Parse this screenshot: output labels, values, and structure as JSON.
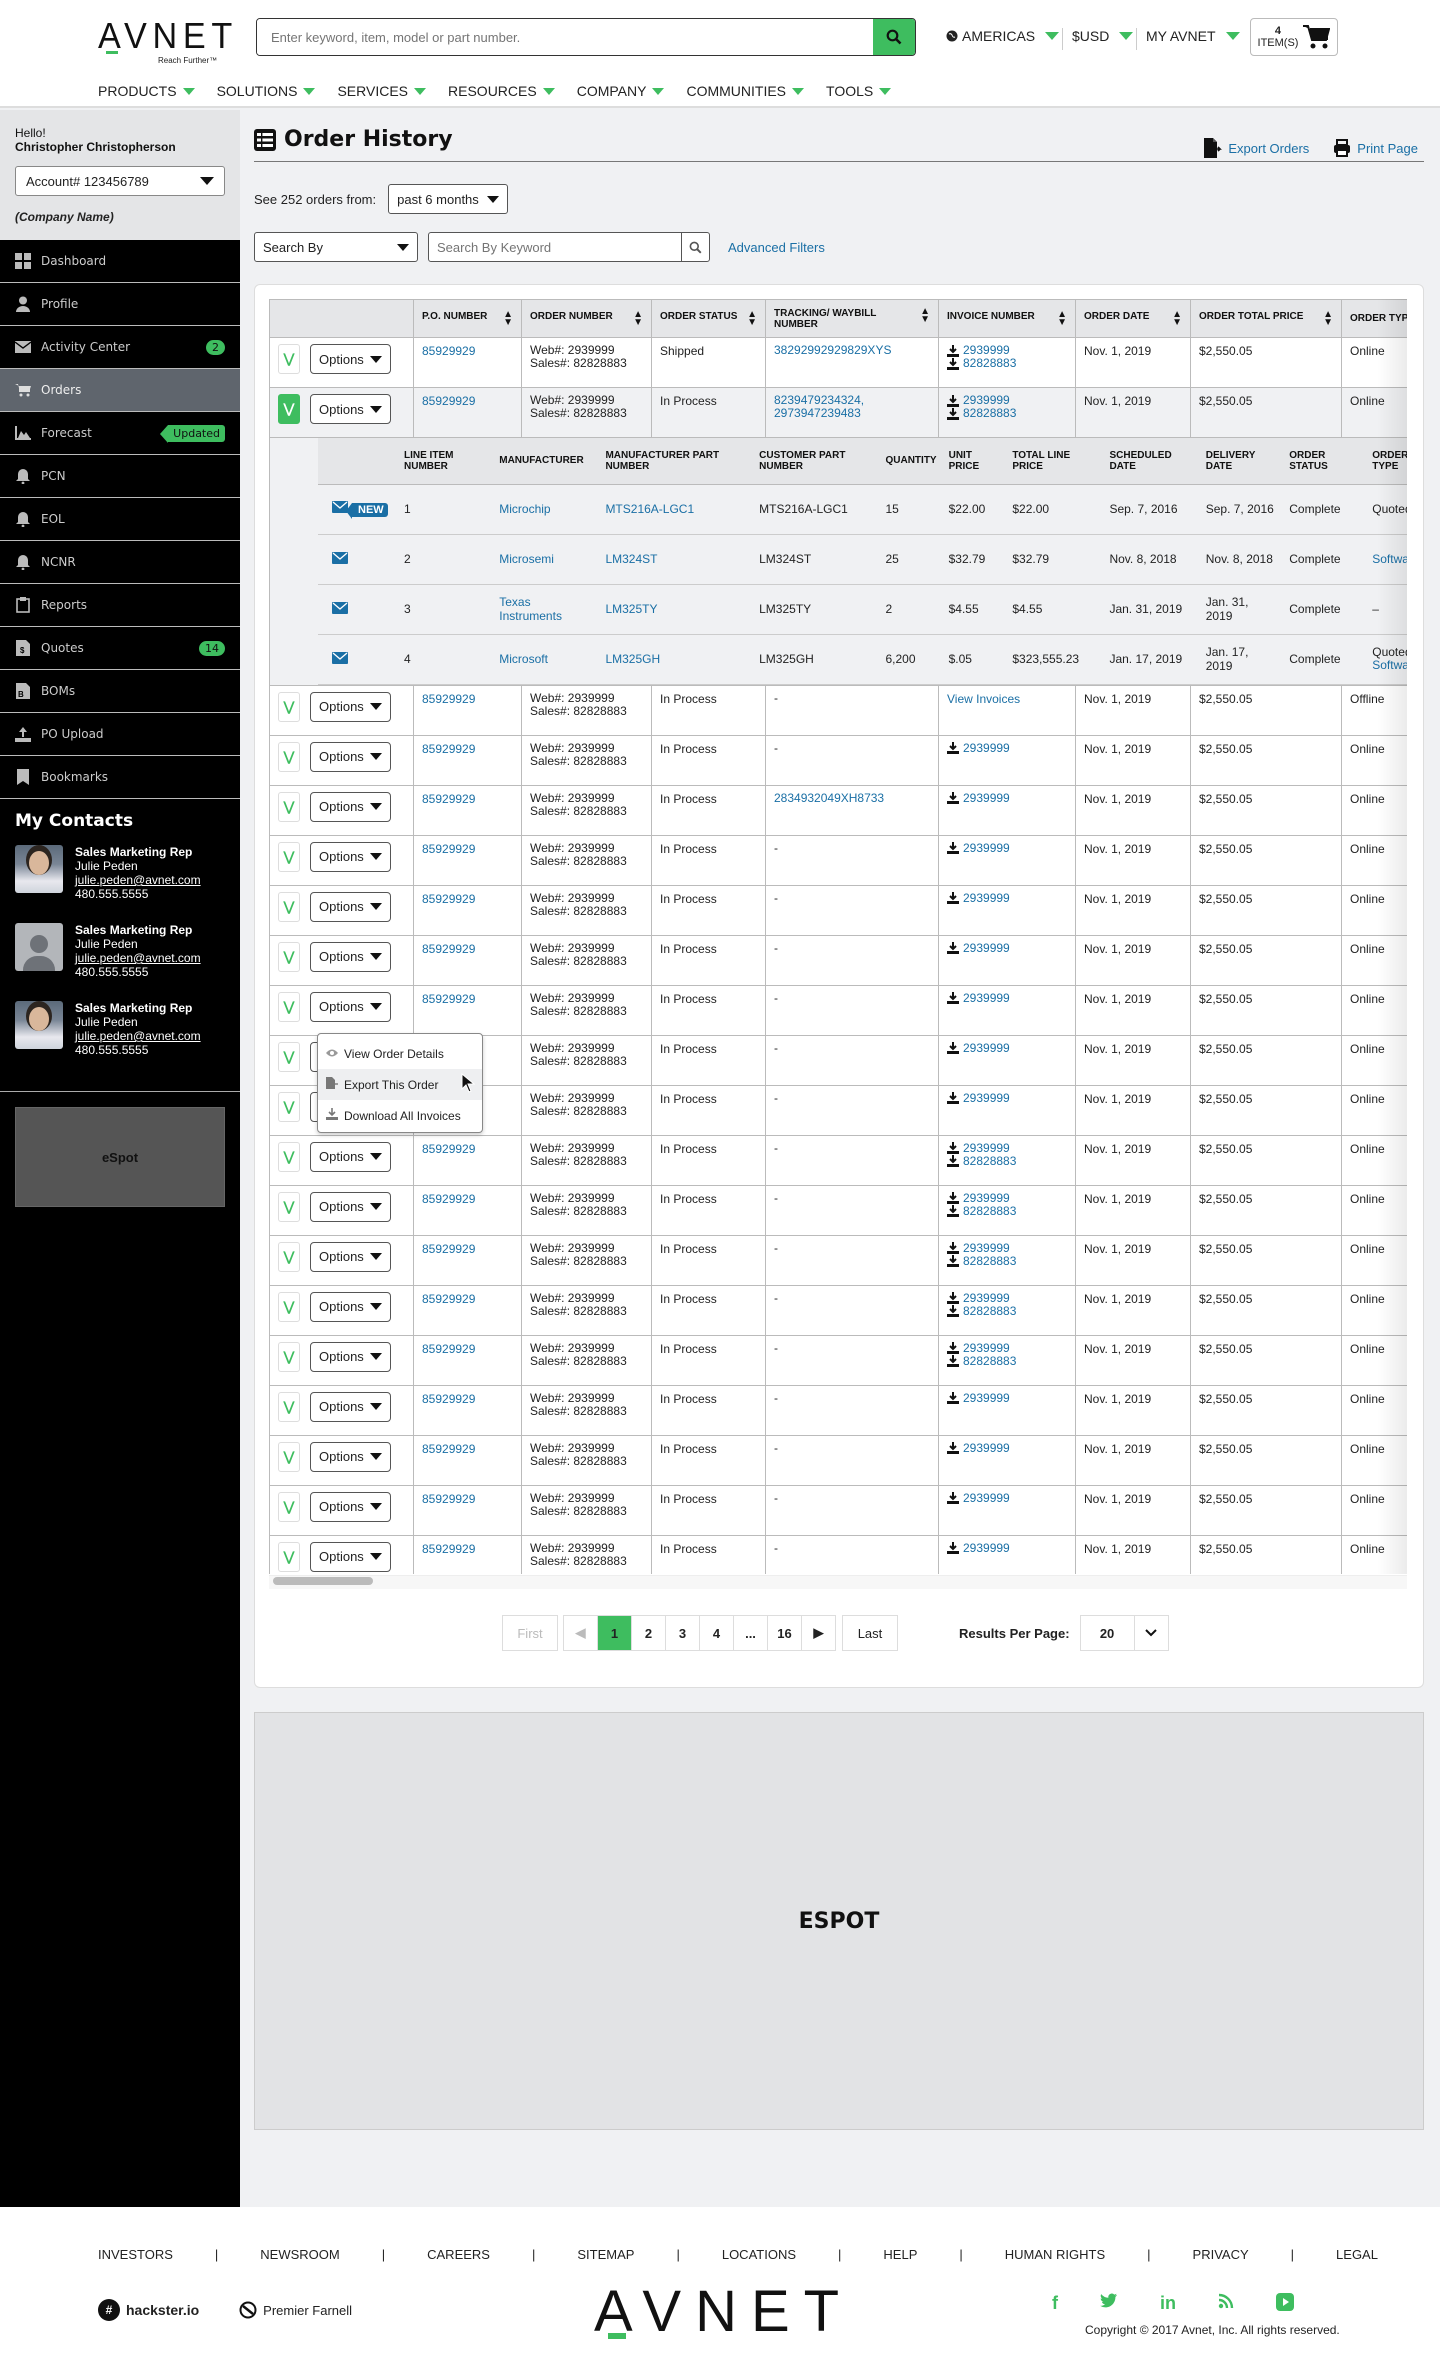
{
  "header": {
    "logo_text": "AVNET",
    "logo_tagline": "Reach Further™",
    "search_placeholder": "Enter keyword, item, model or part number.",
    "region": "AMERICAS",
    "currency": "$USD",
    "account_menu": "MY AVNET",
    "cart_count": "4",
    "cart_label": "ITEM(S)",
    "nav": [
      "PRODUCTS",
      "SOLUTIONS",
      "SERVICES",
      "RESOURCES",
      "COMPANY",
      "COMMUNITIES",
      "TOOLS"
    ],
    "accent_color": "#3ebd5f"
  },
  "sidebar": {
    "greeting": "Hello!",
    "user_name": "Christopher Christopherson",
    "account": "Account# 123456789",
    "company": "(Company Name)",
    "items": [
      {
        "label": "Dashboard",
        "icon": "dashboard-icon"
      },
      {
        "label": "Profile",
        "icon": "user-icon"
      },
      {
        "label": "Activity Center",
        "icon": "envelope-icon",
        "badge": "2"
      },
      {
        "label": "Orders",
        "icon": "cart-icon",
        "active": true
      },
      {
        "label": "Forecast",
        "icon": "area-chart-icon",
        "tag": "Updated"
      },
      {
        "label": "PCN",
        "icon": "bell-icon"
      },
      {
        "label": "EOL",
        "icon": "bell-icon"
      },
      {
        "label": "NCNR",
        "icon": "bell-icon"
      },
      {
        "label": "Reports",
        "icon": "clipboard-icon"
      },
      {
        "label": "Quotes",
        "icon": "quote-doc-icon",
        "badge": "14"
      },
      {
        "label": "BOMs",
        "icon": "bom-doc-icon"
      },
      {
        "label": "PO Upload",
        "icon": "upload-icon"
      },
      {
        "label": "Bookmarks",
        "icon": "bookmark-icon"
      }
    ],
    "contacts_title": "My Contacts",
    "contacts": [
      {
        "role": "Sales Marketing Rep",
        "name": "Julie Peden",
        "email": "julie.peden@avnet.com",
        "phone": "480.555.5555",
        "photo": true
      },
      {
        "role": "Sales Marketing Rep",
        "name": "Julie Peden",
        "email": "julie.peden@avnet.com",
        "phone": "480.555.5555",
        "photo": false
      },
      {
        "role": "Sales Marketing Rep",
        "name": "Julie Peden",
        "email": "julie.peden@avnet.com",
        "phone": "480.555.5555",
        "photo": true
      }
    ],
    "espot": "eSpot"
  },
  "main": {
    "title": "Order History",
    "export_orders": "Export Orders",
    "print_page": "Print Page",
    "orders_from_label": "See 252 orders from:",
    "period": "past 6 months",
    "search_by": "Search By",
    "keyword_placeholder": "Search By Keyword",
    "advanced_filters": "Advanced Filters",
    "columns": [
      "P.O. NUMBER",
      "ORDER NUMBER",
      "ORDER STATUS",
      "TRACKING/ WAYBILL NUMBER",
      "INVOICE NUMBER",
      "ORDER DATE",
      "ORDER TOTAL PRICE",
      "ORDER TYPE"
    ],
    "options_label": "Options",
    "rows": [
      {
        "po": "85929929",
        "web": "Web#: 2939999",
        "sales": "Sales#: 82828883",
        "status": "Shipped",
        "tracking": [
          "38292992929829XYS"
        ],
        "invoices": [
          "2939999",
          "82828883"
        ],
        "date": "Nov. 1, 2019",
        "total": "$2,550.05",
        "type": "Online"
      },
      {
        "po": "85929929",
        "web": "Web#: 2939999",
        "sales": "Sales#: 82828883",
        "status": "In Process",
        "tracking": [
          "8239479234324,",
          "2973947239483"
        ],
        "invoices": [
          "2939999",
          "82828883"
        ],
        "date": "Nov. 1, 2019",
        "total": "$2,550.05",
        "type": "Online",
        "expanded": true
      },
      {
        "po": "85929929",
        "web": "Web#: 2939999",
        "sales": "Sales#: 82828883",
        "status": "In Process",
        "tracking_text": "-",
        "invoice_link": "View Invoices",
        "date": "Nov. 1, 2019",
        "total": "$2,550.05",
        "type": "Offline",
        "menu_open": true
      },
      {
        "po": "85929929",
        "web": "Web#: 2939999",
        "sales": "Sales#: 82828883",
        "status": "In Process",
        "tracking_text": "-",
        "invoices": [
          "2939999"
        ],
        "date": "Nov. 1, 2019",
        "total": "$2,550.05",
        "type": "Online"
      },
      {
        "po": "85929929",
        "web": "Web#: 2939999",
        "sales": "Sales#: 82828883",
        "status": "In Process",
        "tracking": [
          "2834932049XH8733"
        ],
        "invoices": [
          "2939999"
        ],
        "date": "Nov. 1, 2019",
        "total": "$2,550.05",
        "type": "Online"
      },
      {
        "po": "85929929",
        "web": "Web#: 2939999",
        "sales": "Sales#: 82828883",
        "status": "In Process",
        "tracking_text": "-",
        "invoices": [
          "2939999"
        ],
        "date": "Nov. 1, 2019",
        "total": "$2,550.05",
        "type": "Online"
      },
      {
        "po": "85929929",
        "web": "Web#: 2939999",
        "sales": "Sales#: 82828883",
        "status": "In Process",
        "tracking_text": "-",
        "invoices": [
          "2939999"
        ],
        "date": "Nov. 1, 2019",
        "total": "$2,550.05",
        "type": "Online"
      },
      {
        "po": "85929929",
        "web": "Web#: 2939999",
        "sales": "Sales#: 82828883",
        "status": "In Process",
        "tracking_text": "-",
        "invoices": [
          "2939999"
        ],
        "date": "Nov. 1, 2019",
        "total": "$2,550.05",
        "type": "Online"
      },
      {
        "po": "85929929",
        "web": "Web#: 2939999",
        "sales": "Sales#: 82828883",
        "status": "In Process",
        "tracking_text": "-",
        "invoices": [
          "2939999"
        ],
        "date": "Nov. 1, 2019",
        "total": "$2,550.05",
        "type": "Online"
      },
      {
        "po": "85929929",
        "web": "Web#: 2939999",
        "sales": "Sales#: 82828883",
        "status": "In Process",
        "tracking_text": "-",
        "invoices": [
          "2939999"
        ],
        "date": "Nov. 1, 2019",
        "total": "$2,550.05",
        "type": "Online"
      },
      {
        "po": "85929929",
        "web": "Web#: 2939999",
        "sales": "Sales#: 82828883",
        "status": "In Process",
        "tracking_text": "-",
        "invoices": [
          "2939999"
        ],
        "date": "Nov. 1, 2019",
        "total": "$2,550.05",
        "type": "Online"
      },
      {
        "po": "85929929",
        "web": "Web#: 2939999",
        "sales": "Sales#: 82828883",
        "status": "In Process",
        "tracking_text": "-",
        "invoices": [
          "2939999",
          "82828883"
        ],
        "date": "Nov. 1, 2019",
        "total": "$2,550.05",
        "type": "Online"
      },
      {
        "po": "85929929",
        "web": "Web#: 2939999",
        "sales": "Sales#: 82828883",
        "status": "In Process",
        "tracking_text": "-",
        "invoices": [
          "2939999",
          "82828883"
        ],
        "date": "Nov. 1, 2019",
        "total": "$2,550.05",
        "type": "Online"
      },
      {
        "po": "85929929",
        "web": "Web#: 2939999",
        "sales": "Sales#: 82828883",
        "status": "In Process",
        "tracking_text": "-",
        "invoices": [
          "2939999",
          "82828883"
        ],
        "date": "Nov. 1, 2019",
        "total": "$2,550.05",
        "type": "Online"
      },
      {
        "po": "85929929",
        "web": "Web#: 2939999",
        "sales": "Sales#: 82828883",
        "status": "In Process",
        "tracking_text": "-",
        "invoices": [
          "2939999",
          "82828883"
        ],
        "date": "Nov. 1, 2019",
        "total": "$2,550.05",
        "type": "Online"
      },
      {
        "po": "85929929",
        "web": "Web#: 2939999",
        "sales": "Sales#: 82828883",
        "status": "In Process",
        "tracking_text": "-",
        "invoices": [
          "2939999",
          "82828883"
        ],
        "date": "Nov. 1, 2019",
        "total": "$2,550.05",
        "type": "Online"
      },
      {
        "po": "85929929",
        "web": "Web#: 2939999",
        "sales": "Sales#: 82828883",
        "status": "In Process",
        "tracking_text": "-",
        "invoices": [
          "2939999"
        ],
        "date": "Nov. 1, 2019",
        "total": "$2,550.05",
        "type": "Online"
      },
      {
        "po": "85929929",
        "web": "Web#: 2939999",
        "sales": "Sales#: 82828883",
        "status": "In Process",
        "tracking_text": "-",
        "invoices": [
          "2939999"
        ],
        "date": "Nov. 1, 2019",
        "total": "$2,550.05",
        "type": "Online"
      },
      {
        "po": "85929929",
        "web": "Web#: 2939999",
        "sales": "Sales#: 82828883",
        "status": "In Process",
        "tracking_text": "-",
        "invoices": [
          "2939999"
        ],
        "date": "Nov. 1, 2019",
        "total": "$2,550.05",
        "type": "Online"
      },
      {
        "po": "85929929",
        "web": "Web#: 2939999",
        "sales": "Sales#: 82828883",
        "status": "In Process",
        "tracking_text": "-",
        "invoices": [
          "2939999"
        ],
        "date": "Nov. 1, 2019",
        "total": "$2,550.05",
        "type": "Online"
      }
    ],
    "line_columns": [
      "LINE ITEM NUMBER",
      "MANUFACTURER",
      "MANUFACTURER PART NUMBER",
      "CUSTOMER PART NUMBER",
      "QUANTITY",
      "UNIT PRICE",
      "TOTAL LINE PRICE",
      "SCHEDULED DATE",
      "DELIVERY DATE",
      "ORDER STATUS",
      "ORDER TYPE"
    ],
    "line_items": [
      {
        "new": "NEW",
        "num": "1",
        "mfr": "Microchip",
        "mpn": "MTS216A-LGC1",
        "cpn": "MTS216A-LGC1",
        "qty": "15",
        "unit": "$22.00",
        "total": "$22.00",
        "sched": "Sep. 7, 2016",
        "deliv": "Sep. 7, 2016",
        "status": "Complete",
        "type": [
          "Quoted"
        ],
        "type_link": []
      },
      {
        "num": "2",
        "mfr": "Microsemi",
        "mpn": "LM324ST",
        "cpn": "LM324ST",
        "qty": "25",
        "unit": "$32.79",
        "total": "$32.79",
        "sched": "Nov. 8, 2018",
        "deliv": "Nov. 8, 2018",
        "status": "Complete",
        "type": [],
        "type_link": [
          "Software"
        ]
      },
      {
        "num": "3",
        "mfr": "Texas Instruments",
        "mpn": "LM325TY",
        "cpn": "LM325TY",
        "qty": "2",
        "unit": "$4.55",
        "total": "$4.55",
        "sched": "Jan. 31, 2019",
        "deliv": "Jan. 31, 2019",
        "status": "Complete",
        "type": [
          "–"
        ],
        "type_link": []
      },
      {
        "num": "4",
        "mfr": "Microsoft",
        "mpn": "LM325GH",
        "cpn": "LM325GH",
        "qty": "6,200",
        "unit": "$.05",
        "total": "$323,555.23",
        "sched": "Jan. 17, 2019",
        "deliv": "Jan. 17, 2019",
        "status": "Complete",
        "type": [
          "Quoted"
        ],
        "type_link": [
          "Software"
        ]
      }
    ],
    "options_menu": [
      {
        "label": "View Order Details",
        "icon": "eye-icon"
      },
      {
        "label": "Export This Order",
        "icon": "export-file-icon"
      },
      {
        "label": "Download All Invoices",
        "icon": "download-icon"
      }
    ],
    "pagination": {
      "first": "First",
      "pages": [
        "1",
        "2",
        "3",
        "4",
        "...",
        "16"
      ],
      "current": "1",
      "last": "Last"
    },
    "results_per_page_label": "Results Per Page:",
    "results_per_page": "20",
    "espot": "ESPOT"
  },
  "footer": {
    "links": [
      "INVESTORS",
      "NEWSROOM",
      "CAREERS",
      "SITEMAP",
      "LOCATIONS",
      "HELP",
      "HUMAN RIGHTS",
      "PRIVACY",
      "LEGAL"
    ],
    "partners": [
      "hackster.io",
      "Premier Farnell"
    ],
    "logo": "AVNET",
    "social": [
      "facebook",
      "twitter",
      "linkedin",
      "rss",
      "youtube"
    ],
    "copyright": "Copyright © 2017 Avnet, Inc. All rights reserved."
  }
}
